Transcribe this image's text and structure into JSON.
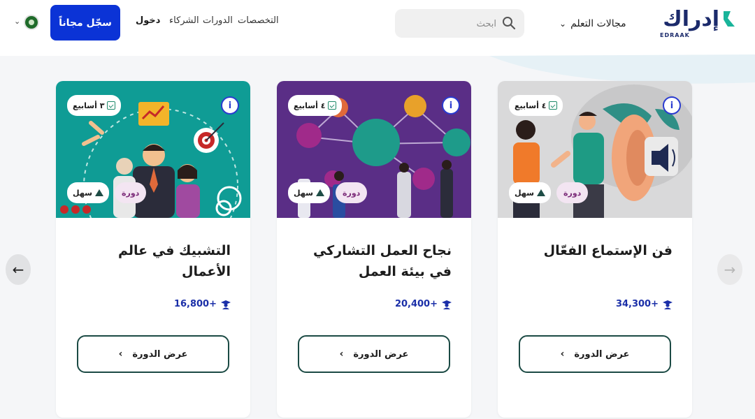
{
  "header": {
    "logo_ar": "إدراك",
    "logo_en": "EDRAAK",
    "nav_areas": "مجالات التعلم",
    "search_placeholder": "ابحث",
    "nav_specializations": "التخصصات",
    "nav_courses": "الدورات",
    "nav_partners": "الشركاء",
    "login": "دخول",
    "signup": "سجّل مجاناً"
  },
  "carousel": {
    "prev_arrow": "←",
    "next_arrow": "→"
  },
  "cards": [
    {
      "title": "فن الإستماع الفعّال",
      "duration": "٤ أسابيع",
      "level": "سهل",
      "type": "دورة",
      "learners": "34,300+",
      "button": "عرض الدورة"
    },
    {
      "title": "نجاح العمل التشاركي في بيئة العمل",
      "duration": "٤ أسابيع",
      "level": "سهل",
      "type": "دورة",
      "learners": "20,400+",
      "button": "عرض الدورة"
    },
    {
      "title": "التشبيك في عالم الأعمال",
      "duration": "٣ أسابيع",
      "level": "سهل",
      "type": "دورة",
      "learners": "16,800+",
      "button": "عرض الدورة"
    }
  ],
  "colors": {
    "brand_blue": "#0b33d6",
    "brand_teal": "#1b4a44",
    "card1_bg": "#d9d9da",
    "card2_bg": "#5a2e86",
    "card3_bg": "#0f9c95"
  }
}
